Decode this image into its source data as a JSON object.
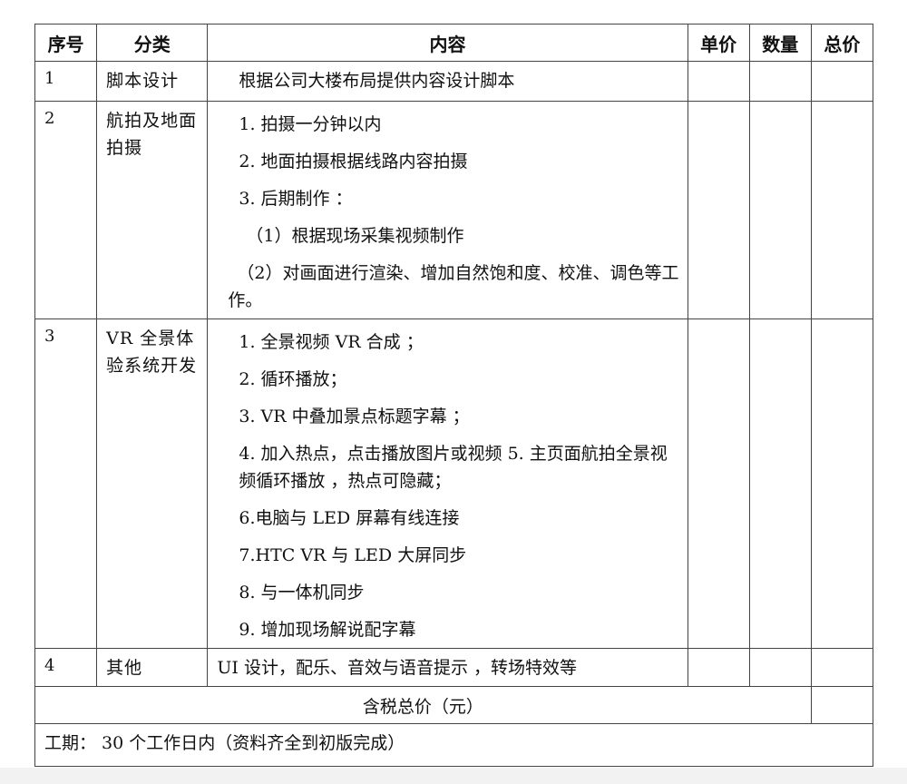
{
  "headers": {
    "no": "序号",
    "category": "分类",
    "content": "内容",
    "unit_price": "单价",
    "quantity": "数量",
    "total": "总价"
  },
  "rows": [
    {
      "no": "1",
      "category": "脚本设计",
      "lines": [
        "根据公司大楼布局提供内容设计脚本"
      ]
    },
    {
      "no": "2",
      "category": "航拍及地面拍摄",
      "lines": [
        "1. 拍摄一分钟以内",
        "2. 地面拍摄根据线路内容拍摄",
        "3. 后期制作 ：",
        "（1）根据现场采集视频制作",
        "（2）对画面进行渲染、增加自然饱和度、校准、调色等工作。"
      ]
    },
    {
      "no": "3",
      "category": "VR 全景体验系统开发",
      "lines": [
        "1. 全景视频 VR 合成 ；",
        "2. 循环播放；",
        "3. VR 中叠加景点标题字幕 ；",
        "4. 加入热点，点击播放图片或视频 5. 主页面航拍全景视频循环播放 ，热点可隐藏；",
        "6.电脑与 LED 屏幕有线连接",
        "7.HTC VR 与 LED 大屏同步",
        "8.  与一体机同步",
        "9.  增加现场解说配字幕"
      ]
    },
    {
      "no": "4",
      "category": "其他",
      "lines": [
        "UI 设计，配乐、音效与语音提示 ，转场特效等"
      ]
    }
  ],
  "total_label": "含税总价（元）",
  "period": "工期： 30 个工作日内（资料齐全到初版完成）"
}
